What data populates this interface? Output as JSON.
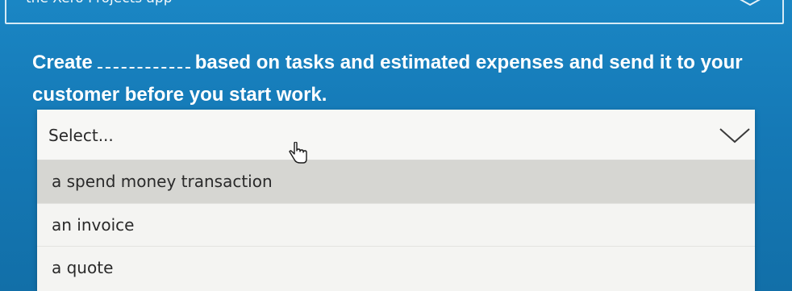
{
  "top_field": {
    "text": "the Xero Projects app"
  },
  "question": {
    "before": "Create",
    "after": "based on tasks and estimated expenses and send it to your customer before you start work."
  },
  "dropdown": {
    "placeholder": "Select...",
    "options": [
      {
        "label": "a spend money transaction",
        "hovered": true
      },
      {
        "label": "an invoice",
        "hovered": false
      },
      {
        "label": "a quote",
        "hovered": false
      }
    ]
  },
  "colors": {
    "background": "#1579b6",
    "dropdown_bg": "#f4f4f2",
    "hover_bg": "#d6d6d2"
  }
}
